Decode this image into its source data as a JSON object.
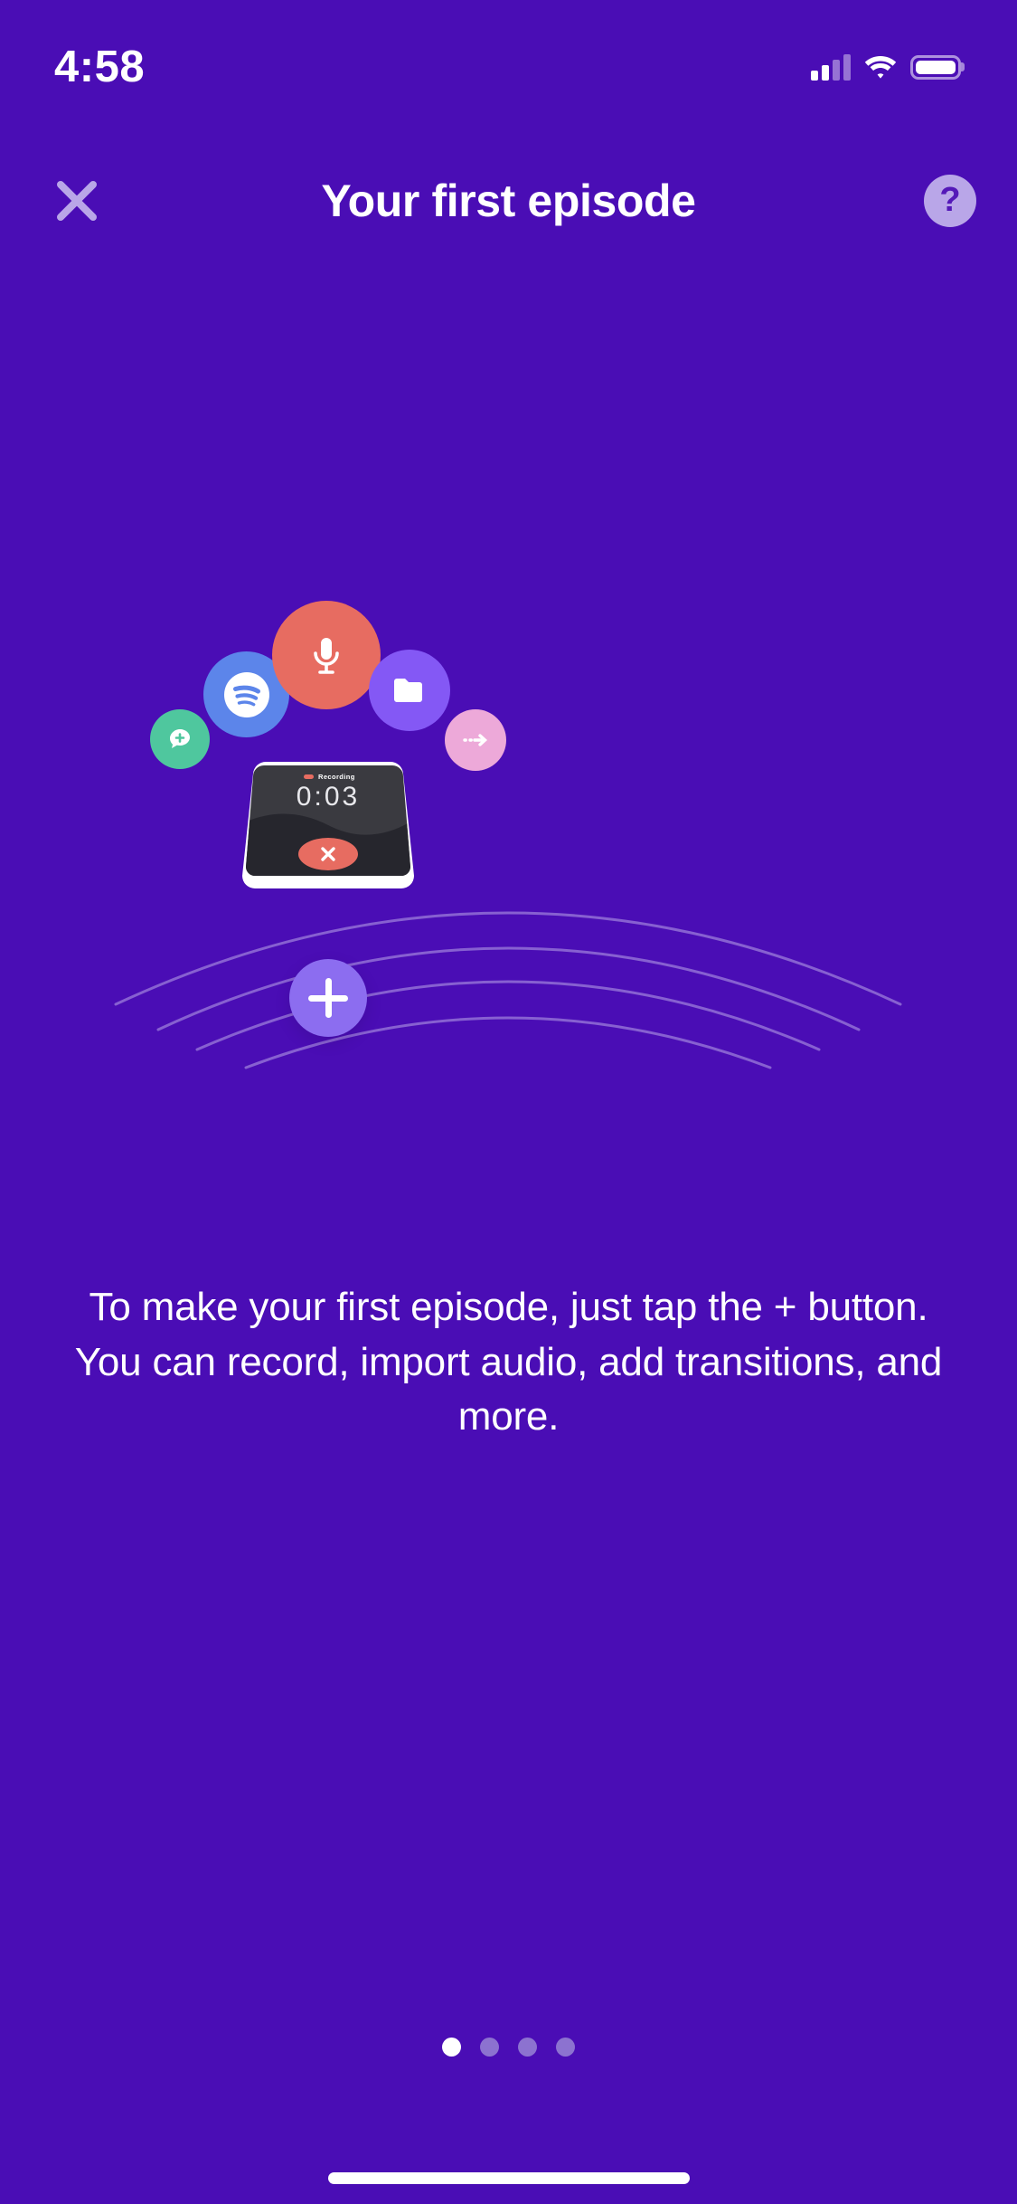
{
  "theme": {
    "background": "#4A0DB5",
    "title_color": "#FFFFFF",
    "accent_purple": "#8C6DF0",
    "help_circle": "#B9A6E8",
    "dot_inactive": "#8C72D0"
  },
  "status_bar": {
    "time": "4:58",
    "cellular_icon": "signal-bars-icon",
    "wifi_icon": "wifi-icon",
    "battery_icon": "battery-full-icon"
  },
  "header": {
    "close_icon": "close-x-icon",
    "close_label": "×",
    "title": "Your first episode",
    "help_icon": "question-mark-icon",
    "help_label": "?"
  },
  "illustration": {
    "name": "first-episode-illustration",
    "bubbles": [
      {
        "id": "chat-add",
        "icon": "chat-bubble-plus-icon",
        "color": "#4FC79E"
      },
      {
        "id": "spotify",
        "icon": "spotify-logo-icon",
        "color": "#5C85EA"
      },
      {
        "id": "microphone",
        "icon": "microphone-icon",
        "color": "#E76C61"
      },
      {
        "id": "folder",
        "icon": "folder-icon",
        "color": "#8458F5"
      },
      {
        "id": "transition",
        "icon": "dashed-arrow-right-icon",
        "color": "#EDA9D9"
      }
    ],
    "phone": {
      "status_label": "Recording",
      "status_dot_color": "#E76C61",
      "timer": "0:03",
      "stop_icon": "stop-x-icon",
      "screen_color": "#3A3A40",
      "screen_color_lower": "#26262D",
      "body_color": "#FFFFFF"
    },
    "add_button": {
      "icon": "plus-icon",
      "label": "+",
      "color": "#8C6DF0"
    }
  },
  "body": {
    "description": "To make your first episode, just tap the + button. You can record, import audio, add transitions, and more."
  },
  "pagination": {
    "total": 4,
    "active_index": 0
  },
  "home_indicator": {
    "name": "home-indicator"
  }
}
